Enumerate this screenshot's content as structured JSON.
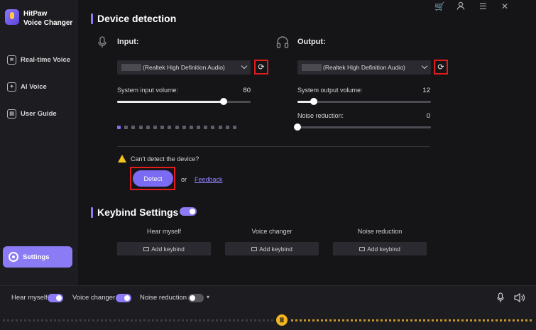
{
  "app": {
    "name_line1": "HitPaw",
    "name_line2": "Voice Changer"
  },
  "sidebar": {
    "items": [
      {
        "label": "Real-time Voice",
        "icon": "waveform-icon"
      },
      {
        "label": "AI Voice",
        "icon": "ai-icon"
      },
      {
        "label": "User Guide",
        "icon": "book-icon"
      }
    ],
    "settings_label": "Settings"
  },
  "topbar": {
    "icons": [
      "cart-icon",
      "user-icon",
      "menu-icon",
      "close-icon"
    ]
  },
  "device_detection": {
    "title": "Device detection",
    "input": {
      "label": "Input:",
      "device": "(Realtek High Definition Audio)",
      "volume_label": "System input volume:",
      "volume": "80",
      "volume_value": 80,
      "level_dots_total": 17,
      "level_dots_active": 1
    },
    "output": {
      "label": "Output:",
      "device": "(Realtek High Definition Audio)",
      "volume_label": "System output volume:",
      "volume": "12",
      "volume_value": 12,
      "noise_label": "Noise reduction:",
      "noise": "0",
      "noise_value": 0
    },
    "cant_detect": "Can't detect the device?",
    "detect_label": "Detect",
    "or_text": "or",
    "feedback_label": "Feedback"
  },
  "keybind": {
    "title": "Keybind Settings",
    "enabled": true,
    "columns": [
      {
        "header": "Hear myself",
        "button": "Add keybind"
      },
      {
        "header": "Voice changer",
        "button": "Add keybind"
      },
      {
        "header": "Noise reduction",
        "button": "Add keybind"
      }
    ]
  },
  "bottom_bar": {
    "hear_myself": "Hear myself",
    "hear_myself_on": true,
    "voice_changer": "Voice changer",
    "voice_changer_on": true,
    "noise_reduction": "Noise reduction",
    "noise_reduction_on": false
  },
  "colors": {
    "accent": "#8b7cf6",
    "highlight_box": "#e21b1b",
    "warning": "#f3c31e",
    "background": "#151518"
  }
}
